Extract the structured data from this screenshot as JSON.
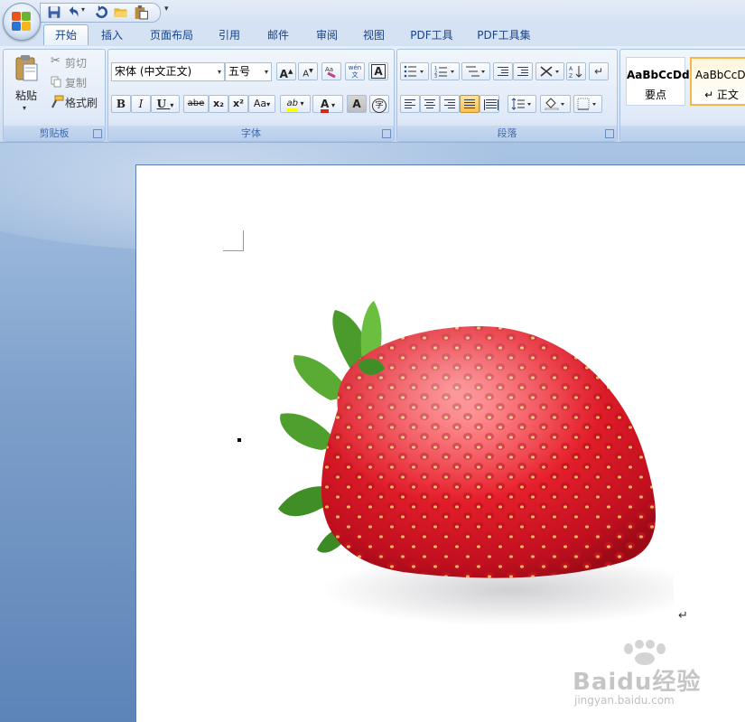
{
  "quick_access": {
    "icons": [
      "save-icon",
      "undo-icon",
      "redo-icon",
      "open-icon",
      "paste-icon"
    ],
    "more": "▾"
  },
  "tabs": [
    {
      "label": "开始",
      "active": true
    },
    {
      "label": "插入"
    },
    {
      "label": "页面布局"
    },
    {
      "label": "引用"
    },
    {
      "label": "邮件"
    },
    {
      "label": "审阅"
    },
    {
      "label": "视图"
    },
    {
      "label": "PDF工具"
    },
    {
      "label": "PDF工具集"
    }
  ],
  "clipboard": {
    "paste_label": "粘贴",
    "cut_label": "剪切",
    "copy_label": "复制",
    "format_painter_label": "格式刷",
    "group_label": "剪贴板"
  },
  "font": {
    "font_name": "宋体 (中文正文)",
    "font_size": "五号",
    "group_label": "字体",
    "grow_label": "A",
    "shrink_label": "A",
    "wen_label": "wén\n文",
    "border_label": "A",
    "bold": "B",
    "italic": "I",
    "underline": "U",
    "strikethrough": "abe",
    "subscript": "x₂",
    "superscript": "x²",
    "change_case": "Aa",
    "highlight": "ab",
    "font_color": "A",
    "shading": "A",
    "enclose": "字"
  },
  "paragraph": {
    "group_label": "段落"
  },
  "styles": {
    "items": [
      {
        "sample": "AaBbCcDd",
        "name": "要点"
      },
      {
        "sample": "AaBbCcDd",
        "name": "↵ 正文"
      }
    ]
  },
  "document": {
    "paragraph_mark": "↵"
  },
  "watermark": {
    "brand": "Baidu经验",
    "url": "jingyan.baidu.com"
  },
  "colors": {
    "ribbon_text": "#15428b",
    "highlight_yellow": "#ffff00",
    "font_red": "#e0201b",
    "selected_style_border": "#f2b94a"
  }
}
